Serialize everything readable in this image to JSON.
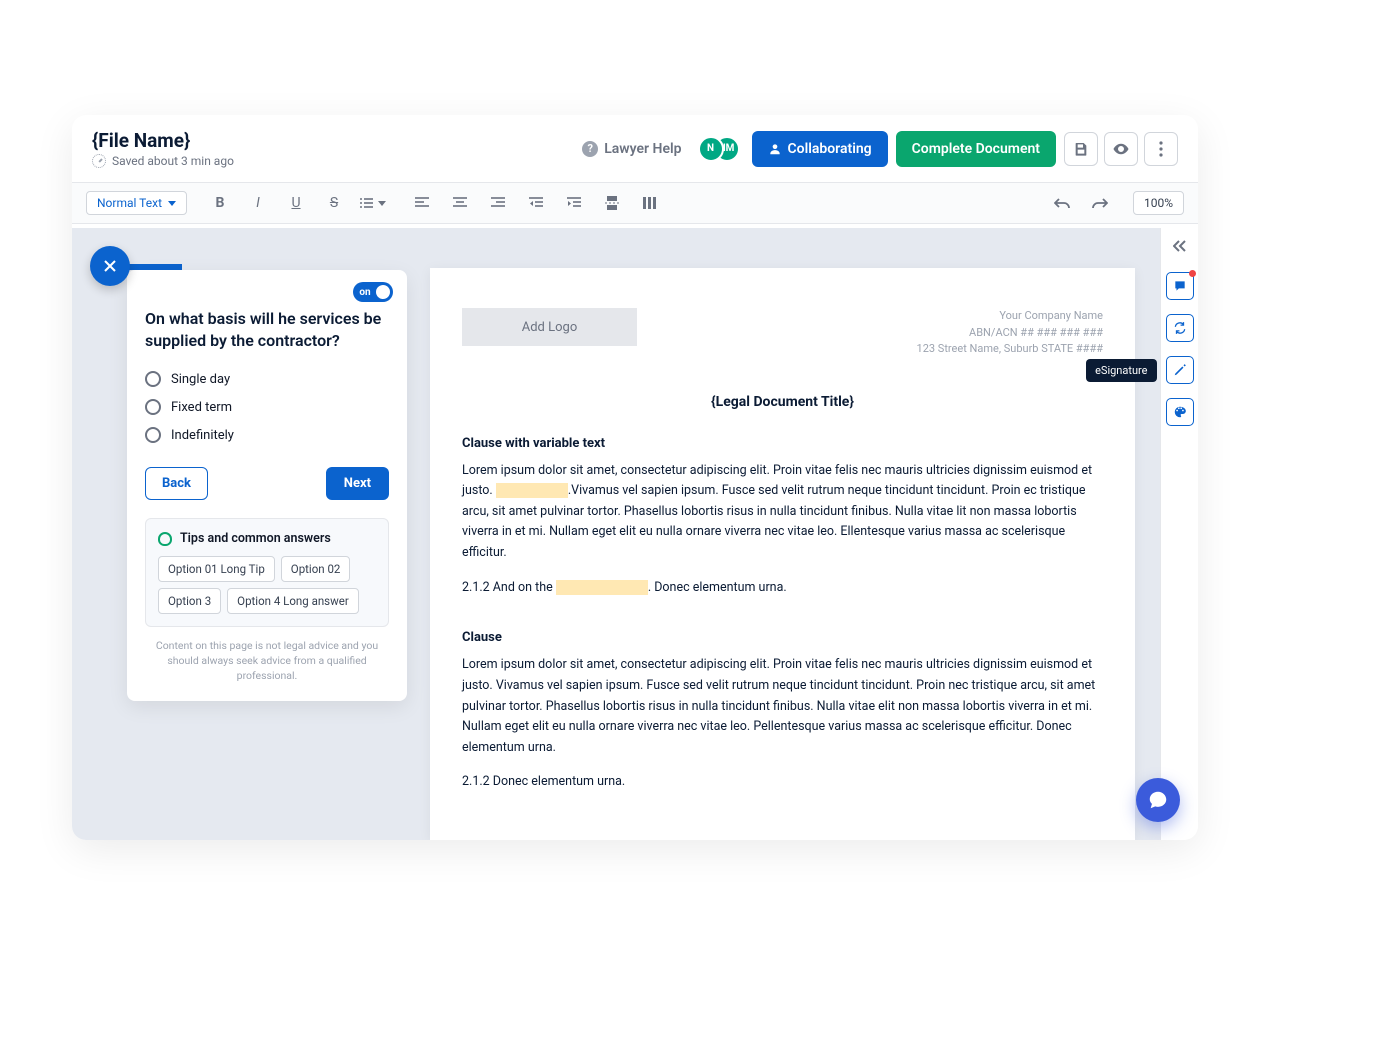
{
  "header": {
    "file_title": "{File Name}",
    "saved_text": "Saved about 3 min ago",
    "lawyer_help": "Lawyer Help",
    "avatars": [
      "N",
      "HM"
    ],
    "collaborating": "Collaborating",
    "complete": "Complete Document"
  },
  "toolbar": {
    "style_select": "Normal Text",
    "zoom": "100%"
  },
  "question_panel": {
    "toggle_label": "on",
    "question": "On what basis will he services be supplied by the contractor?",
    "options": [
      "Single day",
      "Fixed term",
      "Indefinitely"
    ],
    "back": "Back",
    "next": "Next",
    "tips_heading": "Tips and common answers",
    "chips": [
      "Option 01 Long  Tip",
      "Option 02",
      "Option 3",
      "Option 4 Long answer"
    ],
    "disclaimer": "Content on this page is not legal advice and you should always seek advice from a qualified professional."
  },
  "document": {
    "add_logo": "Add Logo",
    "company": {
      "name": "Your Company Name",
      "abn": "ABN/ACN ## ### ### ###",
      "address": "123 Street Name, Suburb STATE ####"
    },
    "title": "{Legal Document Title}",
    "clause1_title": "Clause with variable text",
    "clause1_p1a": "Lorem ipsum dolor sit amet, consectetur adipiscing elit. Proin vitae felis nec mauris ultricies dignissim euismod et justo. ",
    "clause1_p1b": ".Vivamus vel sapien ipsum. Fusce sed velit rutrum neque tincidunt tincidunt. Proin  ec tristique arcu, sit amet pulvinar tortor. Phasellus lobortis risus in nulla tincidunt finibus. Nulla vitae  lit non massa lobortis viverra in et mi. Nullam eget elit eu nulla ornare viverra nec vitae leo. Ellentesque varius massa ac scelerisque efficitur.",
    "clause1_p2a": "2.1.2 And on the ",
    "clause1_p2b": ".  Donec elementum urna.",
    "clause2_title": "Clause",
    "clause2_p1": "Lorem ipsum dolor sit amet, consectetur adipiscing elit. Proin vitae felis nec mauris ultricies dignissim euismod et justo. Vivamus vel sapien ipsum. Fusce sed velit rutrum neque tincidunt tincidunt. Proin nec tristique arcu, sit amet pulvinar tortor. Phasellus lobortis risus in nulla tincidunt finibus. Nulla vitae elit non massa lobortis viverra in et mi. Nullam eget elit eu nulla ornare viverra nec vitae leo. Pellentesque varius massa ac scelerisque efficitur. Donec elementum urna.",
    "clause2_p2": "2.1.2 Donec elementum urna."
  },
  "right_rail": {
    "tooltip": "eSignature"
  }
}
